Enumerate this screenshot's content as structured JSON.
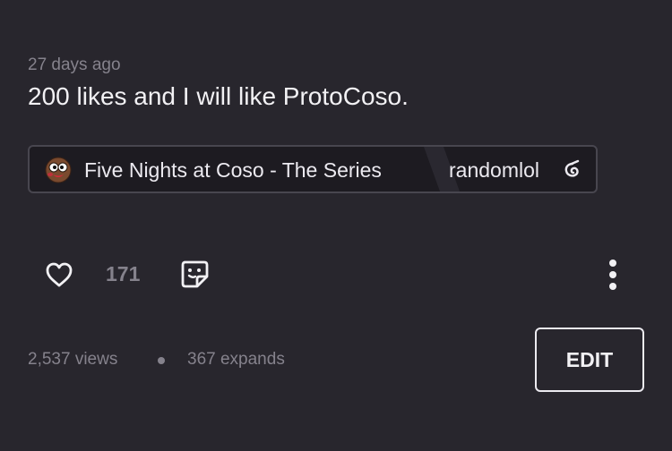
{
  "post": {
    "timestamp": "27 days ago",
    "text": "200 likes and I will like ProtoCoso."
  },
  "tag": {
    "series_name": "Five Nights at Coso - The Series",
    "series_avatar_icon": "cartoon-face-icon",
    "author": "randomlol",
    "author_badge_icon": "swirl-badge-icon"
  },
  "actions": {
    "like_icon": "heart-icon",
    "like_count": "171",
    "sticker_icon": "sticker-icon",
    "more_icon": "vertical-dots-icon"
  },
  "stats": {
    "views": "2,537 views",
    "expands": "367 expands"
  },
  "edit": {
    "label": "EDIT"
  },
  "colors": {
    "background": "#28262d",
    "tag_background": "#1d1b21",
    "primary_text": "#f2f1f4",
    "muted_text": "#85828c"
  }
}
